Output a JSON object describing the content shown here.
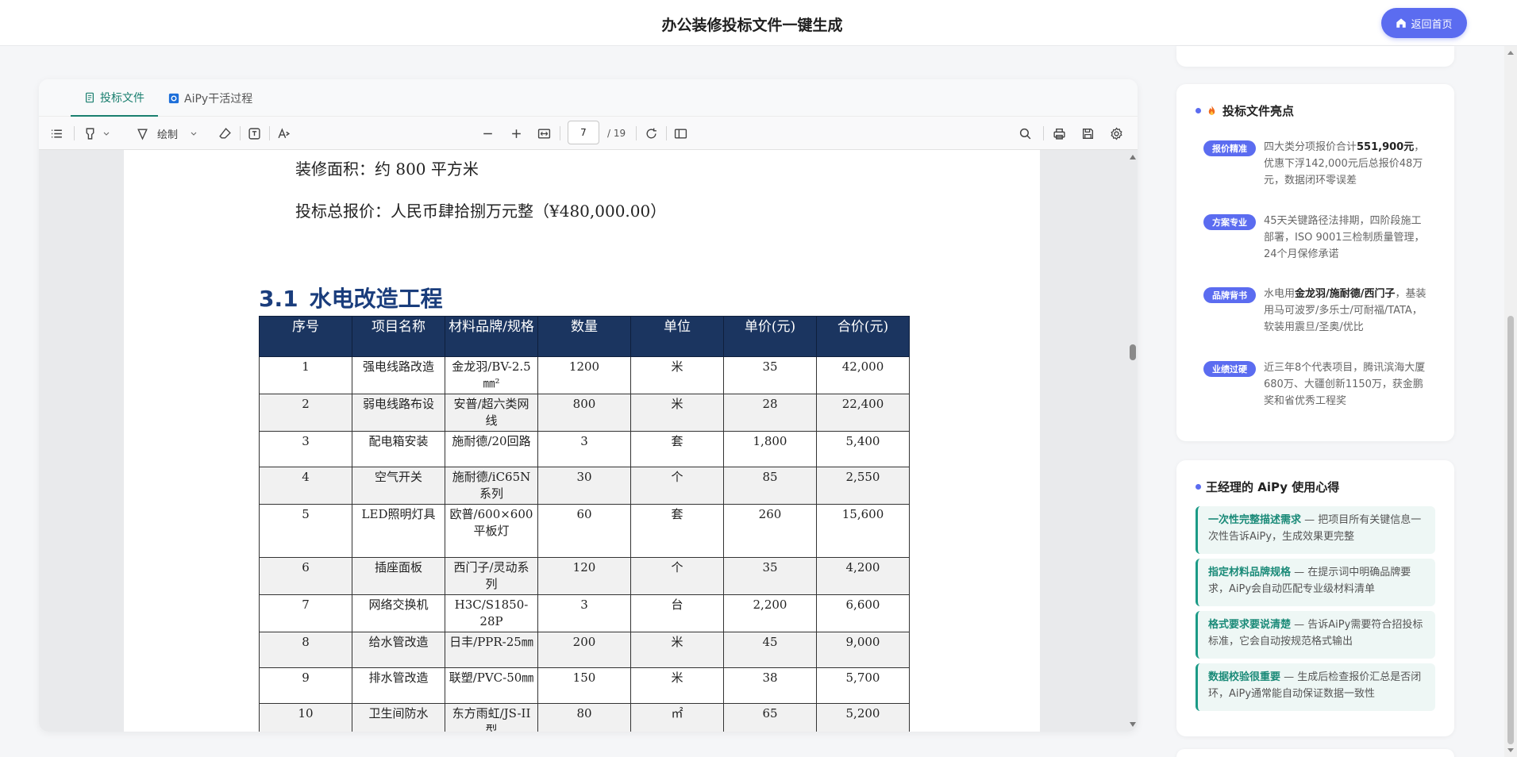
{
  "header": {
    "title": "办公装修投标文件一键生成",
    "home_label": "返回首页"
  },
  "tabs": [
    {
      "label": "投标文件",
      "active": true
    },
    {
      "label": "AiPy干活过程",
      "active": false
    }
  ],
  "toolbar": {
    "draw_label": "绘制",
    "page_current": "7",
    "page_total": "/ 19"
  },
  "pdf": {
    "line_area": "装修面积：约 800 平方米",
    "line_price": "投标总报价：人民币肆拾捌万元整（¥480,000.00）",
    "section_num": "3.1",
    "section_title": "水电改造工程",
    "columns": [
      "序号",
      "项目名称",
      "材料品牌/规格",
      "数量",
      "单位",
      "单价(元)",
      "合价(元)"
    ],
    "rows": [
      [
        "1",
        "强电线路改造",
        "金龙羽/BV-2.5㎜²",
        "1200",
        "米",
        "35",
        "42,000"
      ],
      [
        "2",
        "弱电线路布设",
        "安普/超六类网线",
        "800",
        "米",
        "28",
        "22,400"
      ],
      [
        "3",
        "配电箱安装",
        "施耐德/20回路",
        "3",
        "套",
        "1,800",
        "5,400"
      ],
      [
        "4",
        "空气开关",
        "施耐德/iC65N系列",
        "30",
        "个",
        "85",
        "2,550"
      ],
      [
        "5",
        "LED照明灯具",
        "欧普/600×600平板灯",
        "60",
        "套",
        "260",
        "15,600"
      ],
      [
        "6",
        "插座面板",
        "西门子/灵动系列",
        "120",
        "个",
        "35",
        "4,200"
      ],
      [
        "7",
        "网络交换机",
        "H3C/S1850-28P",
        "3",
        "台",
        "2,200",
        "6,600"
      ],
      [
        "8",
        "给水管改造",
        "日丰/PPR-25㎜",
        "200",
        "米",
        "45",
        "9,000"
      ],
      [
        "9",
        "排水管改造",
        "联塑/PVC-50㎜",
        "150",
        "米",
        "38",
        "5,700"
      ],
      [
        "10",
        "卫生间防水",
        "东方雨虹/JS-II型",
        "80",
        "㎡",
        "65",
        "5,200"
      ]
    ]
  },
  "highlights": {
    "title": "投标文件亮点",
    "items": [
      {
        "badge": "报价精准",
        "text_pre": "四大类分项报价合计",
        "text_bold": "551,900元",
        "text_post": "，优惠下浮142,000元后总报价48万元，数据闭环零误差"
      },
      {
        "badge": "方案专业",
        "text_pre": "45天关键路径法排期，四阶段施工部署，ISO 9001三检制质量管理，24个月保修承诺",
        "text_bold": "",
        "text_post": ""
      },
      {
        "badge": "品牌背书",
        "text_pre": "水电用",
        "text_bold": "金龙羽/施耐德/西门子",
        "text_post": "，基装用马可波罗/多乐士/可耐福/TATA，软装用震旦/圣奥/优比"
      },
      {
        "badge": "业绩过硬",
        "text_pre": "近三年8个代表项目，腾讯滨海大厦680万、大疆创新1150万，获金鹏奖和省优秀工程奖",
        "text_bold": "",
        "text_post": ""
      }
    ]
  },
  "tips": {
    "title": "王经理的 AiPy 使用心得",
    "items": [
      {
        "head": "一次性完整描述需求",
        "body": " — 把项目所有关键信息一次性告诉AiPy，生成效果更完整"
      },
      {
        "head": "指定材料品牌规格",
        "body": " — 在提示词中明确品牌要求，AiPy会自动匹配专业级材料清单"
      },
      {
        "head": "格式要求要说清楚",
        "body": " — 告诉AiPy需要符合招投标标准，它会自动按规范格式输出"
      },
      {
        "head": "数据校验很重要",
        "body": " — 生成后检查报价汇总是否闭环，AiPy通常能自动保证数据一致性"
      }
    ]
  },
  "colors": {
    "accent": "#5b6cf0",
    "teal": "#1a7f6f",
    "table_header": "#1b3560",
    "heading": "#1a3d7c"
  },
  "icons": [
    "home-icon",
    "document-icon",
    "aipy-icon",
    "outline-icon",
    "highlighter-icon",
    "pen-icon",
    "eraser-icon",
    "textbox-icon",
    "font-icon",
    "zoom-out-icon",
    "zoom-in-icon",
    "fit-width-icon",
    "rotate-icon",
    "sidebar-icon",
    "search-icon",
    "print-icon",
    "save-icon",
    "gear-icon",
    "fire-icon"
  ]
}
